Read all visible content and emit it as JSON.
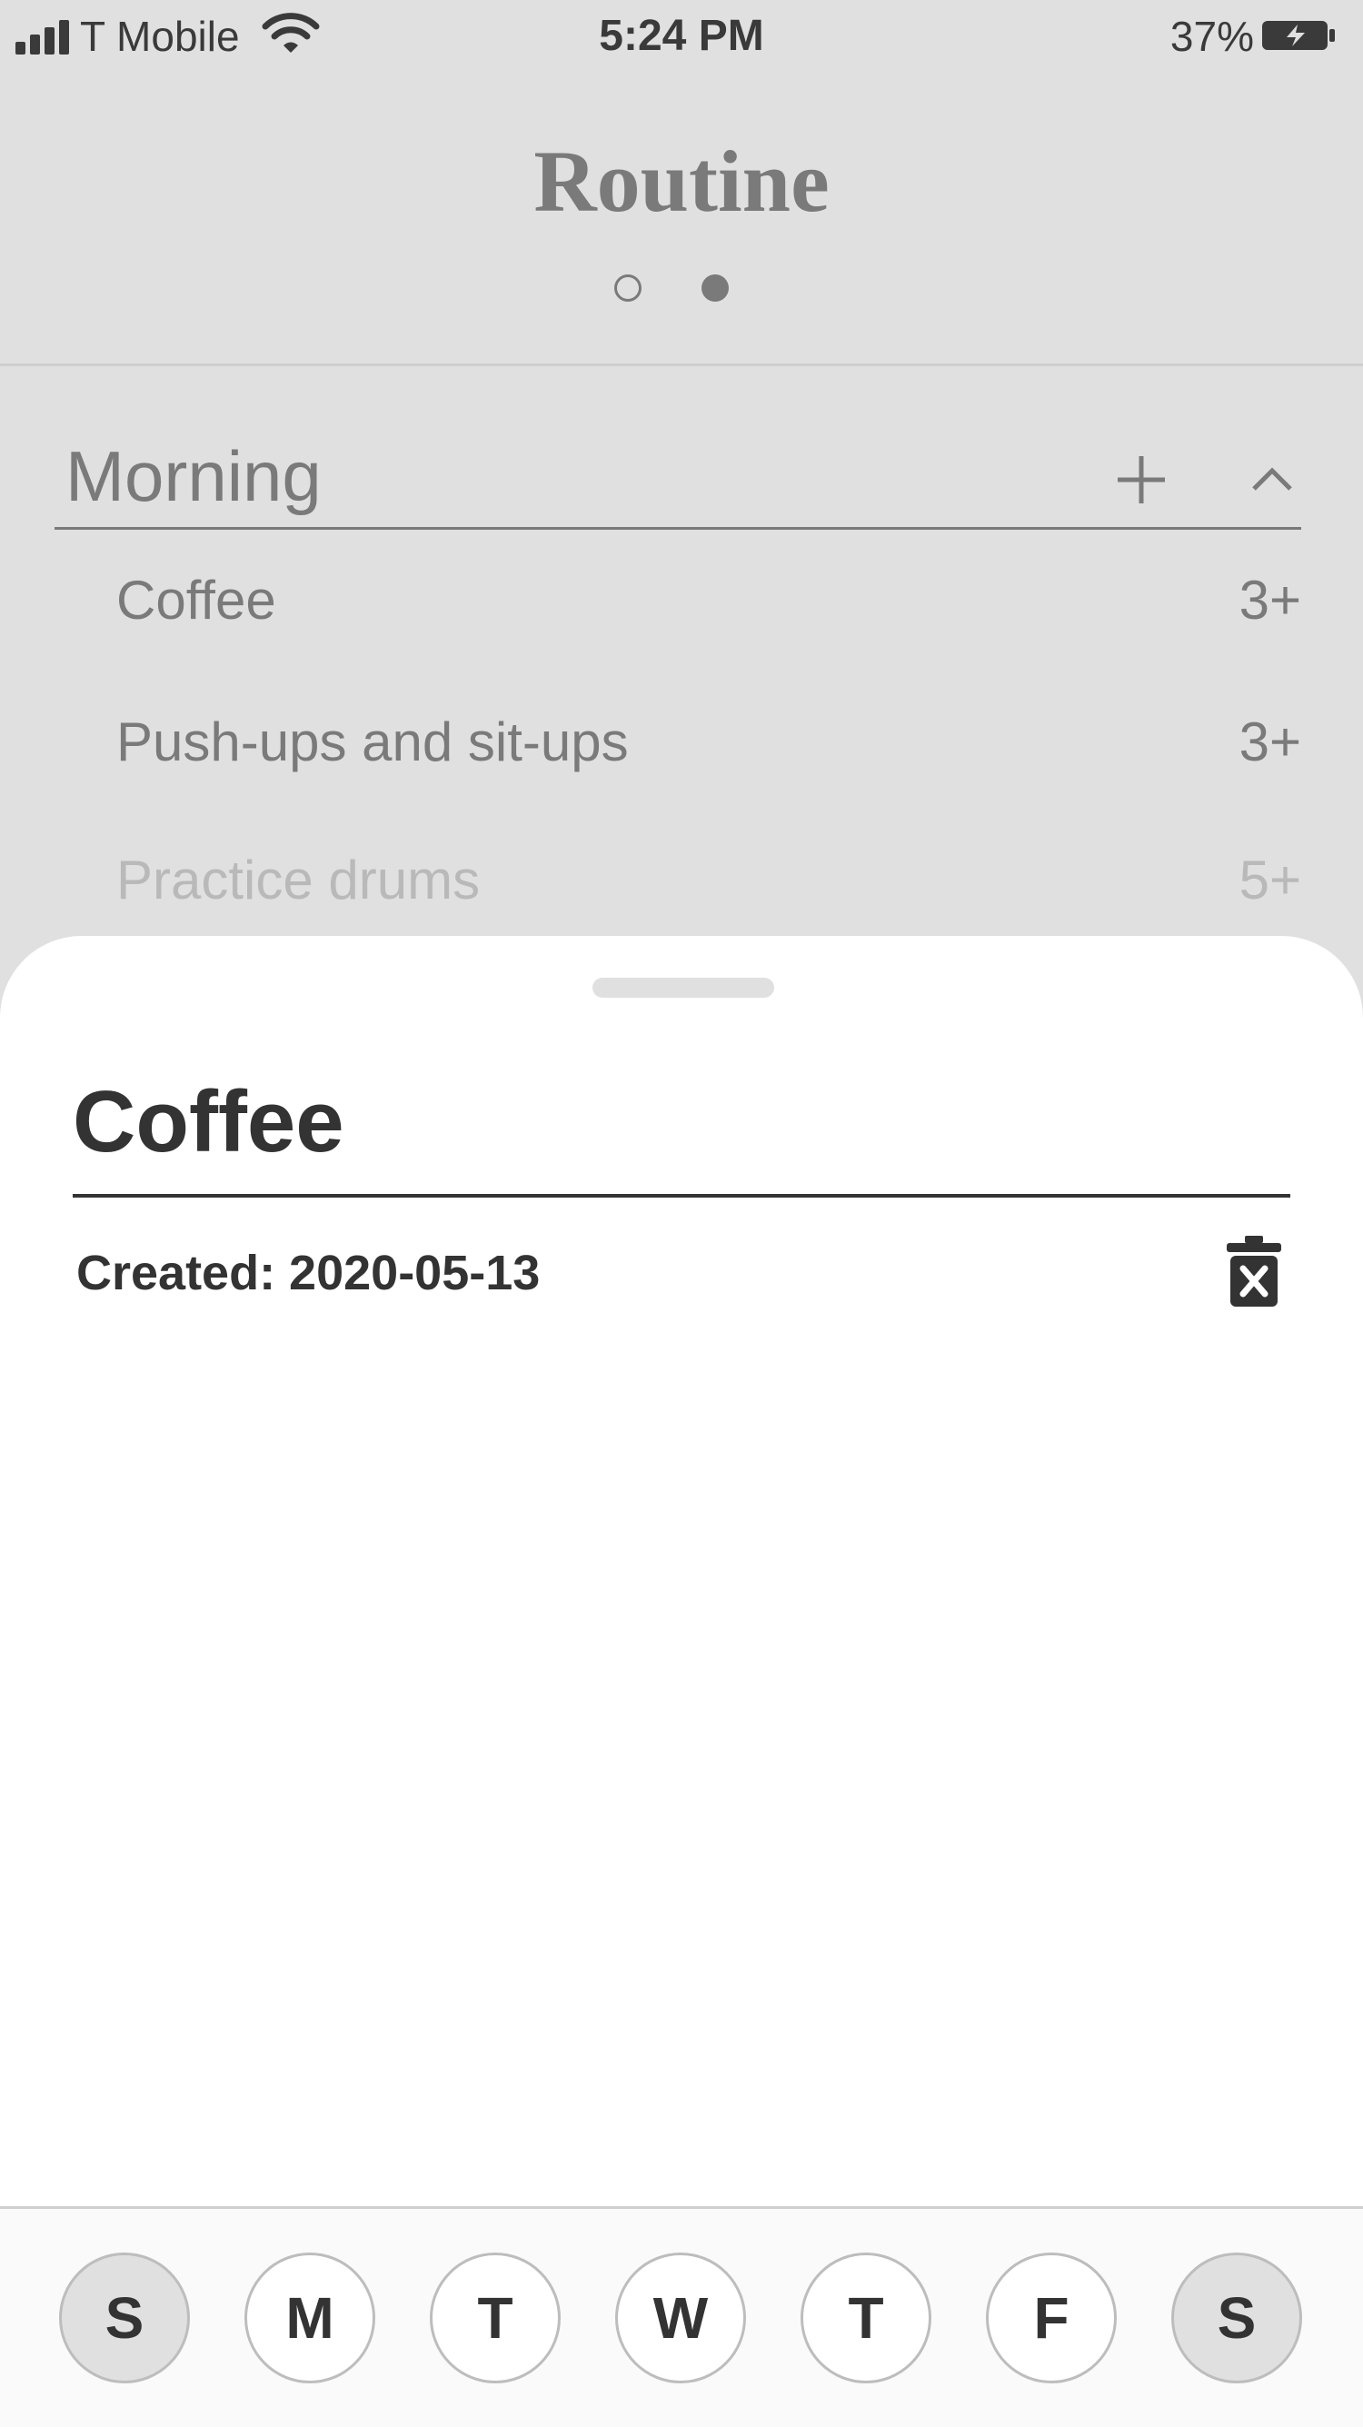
{
  "status_bar": {
    "carrier": "T Mobile",
    "time": "5:24 PM",
    "battery": "37%"
  },
  "header": {
    "title": "Routine",
    "page_indicator": {
      "pages": 2,
      "current": 2
    }
  },
  "section": {
    "title": "Morning",
    "tasks": [
      {
        "name": "Coffee",
        "score": "3+"
      },
      {
        "name": "Push-ups and sit-ups",
        "score": "3+"
      },
      {
        "name": "Practice drums",
        "score": "5+"
      }
    ]
  },
  "sheet": {
    "task_name": "Coffee",
    "created": "Created: 2020-05-13"
  },
  "weekdays": [
    {
      "label": "S",
      "selected": true
    },
    {
      "label": "M",
      "selected": false
    },
    {
      "label": "T",
      "selected": false
    },
    {
      "label": "W",
      "selected": false
    },
    {
      "label": "T",
      "selected": false
    },
    {
      "label": "F",
      "selected": false
    },
    {
      "label": "S",
      "selected": true
    }
  ],
  "colors": {
    "background_dimmed": "#e0e0e0",
    "muted_text": "#7a7a7a",
    "primary_text": "#333333",
    "sheet": "#ffffff"
  }
}
